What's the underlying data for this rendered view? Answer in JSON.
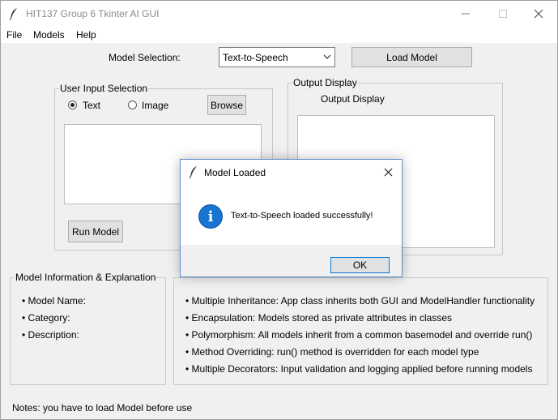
{
  "window": {
    "title": "HIT137 Group 6 Tkinter AI GUI"
  },
  "menu": [
    "File",
    "Models",
    "Help"
  ],
  "model_selection": {
    "label": "Model Selection:",
    "selected": "Text-to-Speech",
    "load_button": "Load Model"
  },
  "input_group": {
    "title": "User Input Selection",
    "radio_text": "Text",
    "radio_image": "Image",
    "radio_selected": "Text",
    "browse_button": "Browse",
    "run_button": "Run Model"
  },
  "output_group": {
    "title": "Output Display",
    "label": "Output Display"
  },
  "model_info": {
    "title": "Model Information & Explanation",
    "items": [
      "• Model Name:",
      "• Category:",
      "• Description:"
    ]
  },
  "oop_info": {
    "items": [
      "• Multiple Inheritance: App class inherits both GUI and ModelHandler functionality",
      "• Encapsulation: Models stored as private attributes in classes",
      "• Polymorphism: All models inherit from a common basemodel and override run()",
      "• Method Overriding: run() method is overridden for each model type",
      "• Multiple Decorators: Input validation and logging applied before running models"
    ]
  },
  "notes": "Notes: you have to load Model before use",
  "dialog": {
    "title": "Model Loaded",
    "message": "Text-to-Speech loaded successfully!",
    "ok_button": "OK",
    "icon": "info-icon"
  },
  "colors": {
    "window_bg": "#f0f0f0",
    "dialog_border": "#5a8fcf",
    "info_icon": "#1874d2",
    "ok_focus": "#0078d7"
  }
}
